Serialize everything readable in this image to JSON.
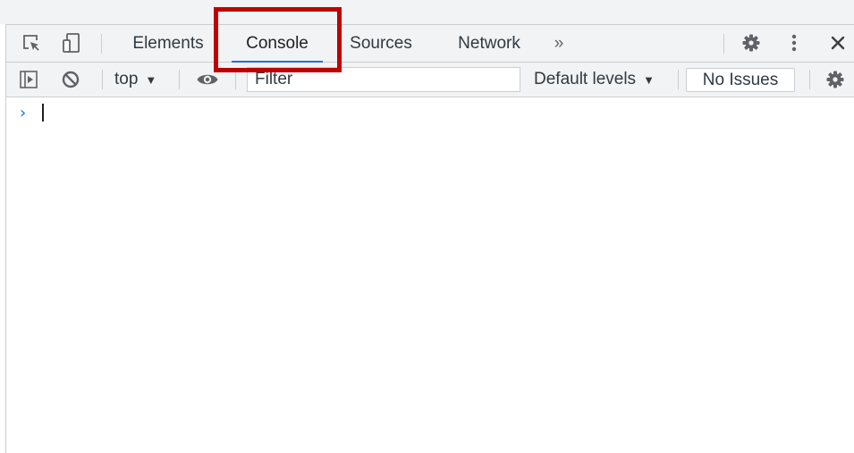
{
  "tabbar": {
    "tabs": [
      {
        "label": "Elements",
        "active": false
      },
      {
        "label": "Console",
        "active": true
      },
      {
        "label": "Sources",
        "active": false
      },
      {
        "label": "Network",
        "active": false
      }
    ],
    "more_tabs_glyph": "»",
    "close_glyph": "✕",
    "icons": [
      "inspect-element-icon",
      "device-toolbar-icon",
      "settings-gear-icon",
      "more-options-kebab-icon",
      "close-icon"
    ]
  },
  "console_toolbar": {
    "context_label": "top",
    "context_arrow": "▼",
    "filter_placeholder": "Filter",
    "levels_label": "Default levels",
    "levels_arrow": "▼",
    "issues_label": "No Issues",
    "icons": [
      "show-sidebar-icon",
      "clear-console-icon",
      "live-expression-eye-icon",
      "console-settings-gear-icon"
    ]
  },
  "console": {
    "prompt_glyph": "›"
  },
  "colors": {
    "accent": "#1a73e8",
    "highlight": "#c00000",
    "toolbar_bg": "#f1f3f4",
    "border": "#cbcdd1"
  }
}
